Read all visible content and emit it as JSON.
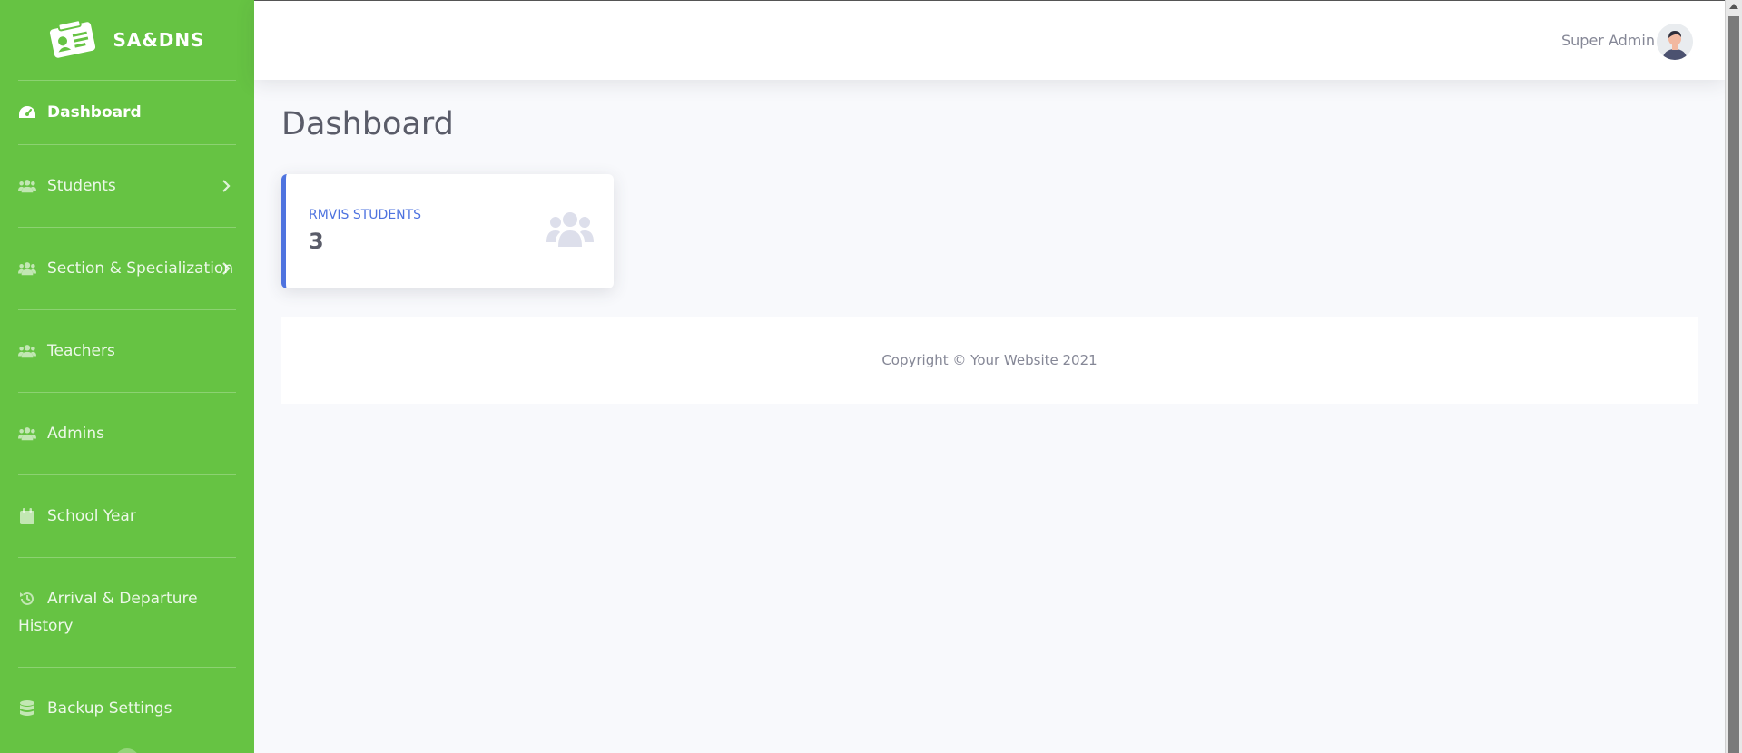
{
  "brand": {
    "name": "SA&DNS",
    "logo_icon": "id-card-icon"
  },
  "sidebar": {
    "items": [
      {
        "label": "Dashboard",
        "icon": "tachometer-icon",
        "active": true,
        "has_submenu": false
      },
      {
        "label": "Students",
        "icon": "users-icon",
        "active": false,
        "has_submenu": true
      },
      {
        "label": "Section & Specialization",
        "icon": "users-icon",
        "active": false,
        "has_submenu": true
      },
      {
        "label": "Teachers",
        "icon": "users-icon",
        "active": false,
        "has_submenu": false
      },
      {
        "label": "Admins",
        "icon": "users-icon",
        "active": false,
        "has_submenu": false
      },
      {
        "label": "School Year",
        "icon": "calendar-icon",
        "active": false,
        "has_submenu": false
      },
      {
        "label": "Arrival & Departure History",
        "label_line1": "Arrival & Departure",
        "label_line2": "History",
        "icon": "history-icon",
        "active": false,
        "has_submenu": false
      },
      {
        "label": "Backup Settings",
        "icon": "database-icon",
        "active": false,
        "has_submenu": false
      }
    ]
  },
  "topbar": {
    "user_name": "Super Admin",
    "avatar_icon": "avatar"
  },
  "main": {
    "title": "Dashboard",
    "cards": [
      {
        "label": "RMVIS STUDENTS",
        "value": "3",
        "icon": "users-icon",
        "accent": "#4e73df"
      }
    ]
  },
  "footer": {
    "copyright": "Copyright © Your Website 2021"
  },
  "colors": {
    "sidebar": "#66c343",
    "accent": "#4e73df",
    "background": "#f8f9fc"
  }
}
